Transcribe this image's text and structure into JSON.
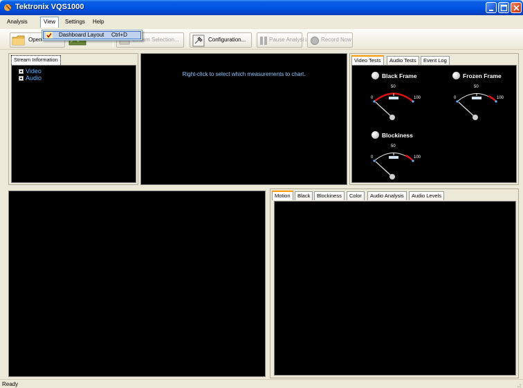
{
  "window": {
    "title": "Tektronix VQS1000"
  },
  "menubar": {
    "items": [
      {
        "label": "Analysis"
      },
      {
        "label": "View"
      },
      {
        "label": "Settings"
      },
      {
        "label": "Help"
      }
    ],
    "view_dropdown": {
      "item_label": "Dashboard Layout",
      "shortcut": "Ctrl+D",
      "checked": true
    }
  },
  "toolbar": {
    "open_label": "Open",
    "stream_selection_label": "Stream Selection...",
    "configuration_label": "Configuration...",
    "pause_label": "Pause Analysis",
    "record_label": "Record Now"
  },
  "stream_info": {
    "tab_label": "Stream Information",
    "items": [
      {
        "label": "Video"
      },
      {
        "label": "Audio"
      }
    ]
  },
  "chart_panel": {
    "hint": "Right-click to select which measurements to chart."
  },
  "tests_panel": {
    "tabs": [
      {
        "label": "Video Tests",
        "active": true
      },
      {
        "label": "Audio Tests",
        "active": false
      },
      {
        "label": "Event Log",
        "active": false
      }
    ],
    "gauges": [
      {
        "title": "Black Frame",
        "min": "0",
        "mid": "50",
        "max": "100",
        "level": 0
      },
      {
        "title": "Frozen Frame",
        "min": "0",
        "mid": "50",
        "max": "100",
        "level": 0
      },
      {
        "title": "Blockiness",
        "min": "0",
        "mid": "50",
        "max": "100",
        "level": 0
      }
    ]
  },
  "bottom_tabs": [
    {
      "label": "Motion",
      "active": true
    },
    {
      "label": "Black",
      "active": false
    },
    {
      "label": "Blockiness",
      "active": false
    },
    {
      "label": "Color",
      "active": false
    },
    {
      "label": "Audio Analysis",
      "active": false
    },
    {
      "label": "Audio Levels",
      "active": false
    }
  ],
  "status": {
    "text": "Ready"
  },
  "colors": {
    "titlebar": "#0055e5",
    "tree_text": "#5ab4ff",
    "hint_text": "#8cc8ff",
    "gauge_red": "#e01010",
    "active_tab_accent": "#ff9d00"
  }
}
